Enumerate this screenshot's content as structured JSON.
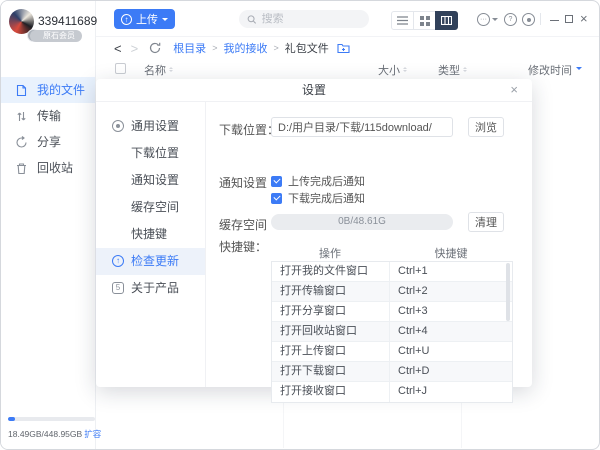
{
  "user": {
    "name": "339411689",
    "badge": "原石会员"
  },
  "toolbar": {
    "upload_label": "上传",
    "search_placeholder": "搜索"
  },
  "window_controls": {
    "close": "×"
  },
  "breadcrumb": {
    "items": [
      "根目录",
      "我的接收",
      "礼包文件"
    ],
    "separator": ">"
  },
  "file_table": {
    "columns": [
      "名称",
      "大小",
      "类型",
      "修改时间"
    ]
  },
  "sidebar": {
    "items": [
      {
        "label": "我的文件",
        "active": true
      },
      {
        "label": "传输",
        "active": false
      },
      {
        "label": "分享",
        "active": false
      },
      {
        "label": "回收站",
        "active": false
      }
    ],
    "storage": {
      "usage_text": "18.49GB/448.95GB",
      "expand_label": "扩容",
      "percent_used": 8
    }
  },
  "dialog": {
    "title": "设置",
    "close_label": "×",
    "menu": [
      {
        "label": "通用设置",
        "active": false
      },
      {
        "label": "下载位置",
        "sub": true
      },
      {
        "label": "通知设置",
        "sub": true
      },
      {
        "label": "缓存空间",
        "sub": true
      },
      {
        "label": "快捷键",
        "sub": true
      },
      {
        "label": "检查更新",
        "active": true
      },
      {
        "label": "关于产品",
        "active": false
      }
    ],
    "about_icon_glyph": "5",
    "download_location": {
      "label": "下载位置：",
      "value": "D:/用户目录/下载/115download/",
      "browse_label": "浏览"
    },
    "notifications": {
      "label": "通知设置",
      "options": [
        {
          "label": "上传完成后通知",
          "checked": true
        },
        {
          "label": "下载完成后通知",
          "checked": true
        }
      ]
    },
    "cache": {
      "label": "缓存空间",
      "usage_text": "0B/48.61G",
      "clean_label": "清理"
    },
    "shortcuts": {
      "label": "快捷键：",
      "columns": [
        "操作",
        "快捷键"
      ],
      "rows": [
        {
          "action": "打开我的文件窗口",
          "keys": "Ctrl+1"
        },
        {
          "action": "打开传输窗口",
          "keys": "Ctrl+2"
        },
        {
          "action": "打开分享窗口",
          "keys": "Ctrl+3"
        },
        {
          "action": "打开回收站窗口",
          "keys": "Ctrl+4"
        },
        {
          "action": "打开上传窗口",
          "keys": "Ctrl+U"
        },
        {
          "action": "打开下载窗口",
          "keys": "Ctrl+D"
        },
        {
          "action": "打开接收窗口",
          "keys": "Ctrl+J"
        }
      ]
    }
  },
  "colors": {
    "accent": "#3c7bf6",
    "active_view_bg": "#31415a",
    "sidebar_active_bg": "#e9f2fd",
    "menu_active_bg": "#edf2fa"
  }
}
